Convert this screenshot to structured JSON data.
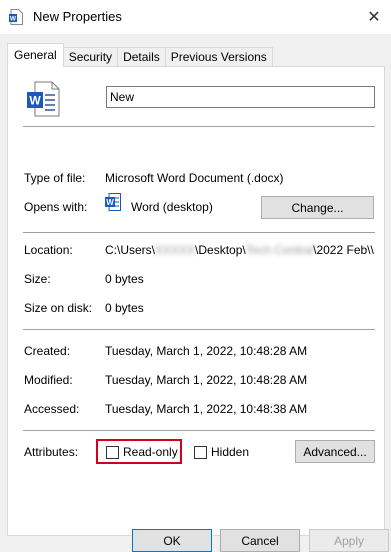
{
  "window": {
    "title": "New Properties",
    "close_icon": "close-icon"
  },
  "tabs": [
    {
      "label": "General",
      "active": true
    },
    {
      "label": "Security",
      "active": false
    },
    {
      "label": "Details",
      "active": false
    },
    {
      "label": "Previous Versions",
      "active": false
    }
  ],
  "general": {
    "file_name": "New",
    "type_label": "Type of file:",
    "type_value": "Microsoft Word Document (.docx)",
    "opens_label": "Opens with:",
    "opens_value": "Word (desktop)",
    "change_button": "Change...",
    "location_label": "Location:",
    "location_parts": {
      "prefix": "C:\\Users\\",
      "user_blur": "XXXXX",
      "mid": "\\Desktop\\",
      "folder_blur": "Tech Central",
      "suffix": "\\2022 Feb\\\\"
    },
    "size_label": "Size:",
    "size_value": "0 bytes",
    "size_on_disk_label": "Size on disk:",
    "size_on_disk_value": "0 bytes",
    "created_label": "Created:",
    "created_value": "Tuesday, March 1, 2022, 10:48:28 AM",
    "modified_label": "Modified:",
    "modified_value": "Tuesday, March 1, 2022, 10:48:28 AM",
    "accessed_label": "Accessed:",
    "accessed_value": "Tuesday, March 1, 2022, 10:48:38 AM",
    "attributes_label": "Attributes:",
    "readonly_label": "Read-only",
    "readonly_checked": false,
    "hidden_label": "Hidden",
    "hidden_checked": false,
    "advanced_button": "Advanced..."
  },
  "buttons": {
    "ok": "OK",
    "cancel": "Cancel",
    "apply": "Apply"
  },
  "colors": {
    "word_blue": "#185abd",
    "highlight_red": "#d0021b",
    "default_button_border": "#0078d7"
  }
}
